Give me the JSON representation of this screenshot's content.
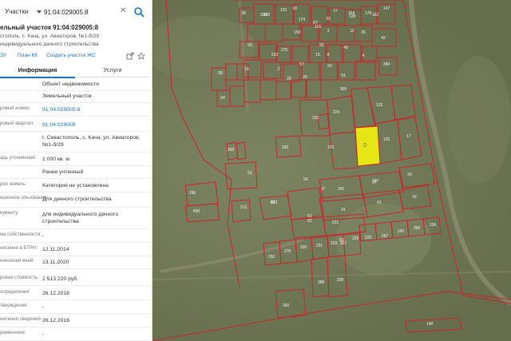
{
  "search": {
    "type": "Участки",
    "query": "91:04:029005:8"
  },
  "header": {
    "title": "ельный участок 91:04:029005:8",
    "address": "стополь, с. Кача, ул. Авиаторов, №1-б/29",
    "kind": "индивидуального дачного строительства"
  },
  "links": {
    "zu": "ЗУ",
    "plan": "План КК",
    "create": "Создать участок ЖС"
  },
  "tabs": {
    "info": "Информация",
    "services": "Услуги"
  },
  "rows": [
    {
      "key": "",
      "value": "Объект недвижимости",
      "link": false
    },
    {
      "key": "",
      "value": "Земельный участок",
      "link": false
    },
    {
      "key": "ровый номер:",
      "value": "91:04:029005:8",
      "link": true
    },
    {
      "key": "ровый квартал:",
      "value": "91:04:029005",
      "link": true
    },
    {
      "key": "",
      "value": "г. Севастополь, с. Кача, ул. Авиаторов, №1-б/29",
      "link": false
    },
    {
      "key": "адь уточненная:",
      "value": "1 000 кв. м",
      "link": false
    },
    {
      "key": "",
      "value": "Ранее учтенный",
      "link": false
    },
    {
      "key": "рия земель:",
      "value": "Категория не установлена",
      "link": false
    },
    {
      "key": "ешенное ользование:",
      "value": "Для дачного строительства",
      "link": false
    },
    {
      "key": "кументу:",
      "value": "для индивидуального дачного строительства",
      "link": false
    },
    {
      "key": "ма собственности:",
      "value": "-",
      "link": false
    },
    {
      "key": "несения в ЕГРН:",
      "value": "12.11.2014",
      "link": false
    },
    {
      "key": "енесения ений:",
      "value": "13.11.2020",
      "link": false
    },
    {
      "key": "ровая стоимость:",
      "value": "2 513 220 руб.",
      "link": false
    },
    {
      "key": "определения:",
      "value": "26.12.2016",
      "link": false
    },
    {
      "key": "тверждения:",
      "value": "-",
      "link": false
    },
    {
      "key": "несения сведений:",
      "value": "26.12.2016",
      "link": false
    },
    {
      "key": "рименения:",
      "value": "-",
      "link": false
    }
  ],
  "map_labels": [
    "0",
    "94",
    "58",
    "296",
    "490",
    "213",
    "305",
    "91",
    "43",
    "61",
    "42",
    "51",
    "56",
    "29",
    "57",
    "63",
    "26",
    "15",
    "55",
    "49",
    "8",
    "12",
    "3",
    "4",
    "133",
    "2",
    "16",
    "41",
    "37",
    "61",
    "132",
    "260",
    "368",
    "176",
    "224",
    "102",
    "17",
    "37",
    "337",
    "341",
    "40",
    "293",
    "61",
    "231",
    "53",
    "125",
    "229",
    "267",
    "242",
    "366",
    "236",
    "160",
    "148",
    "250",
    "378",
    "330",
    "231",
    "229",
    "257",
    "388",
    "208",
    "275",
    "223",
    "174",
    "116",
    "103",
    "136",
    "128",
    "178",
    "147",
    "42",
    "384",
    "67",
    "93",
    "27",
    "18",
    "28",
    "338",
    "23",
    "26",
    "152",
    "164",
    "153"
  ],
  "colors": {
    "parcel": "#c8262c",
    "selected": "#e6e617",
    "link": "#1a73b8"
  }
}
